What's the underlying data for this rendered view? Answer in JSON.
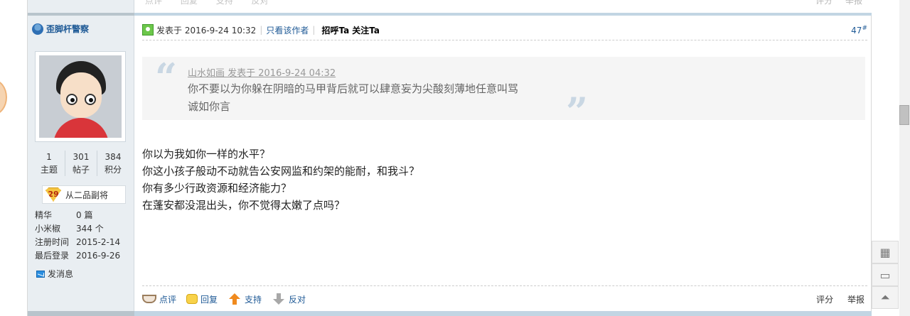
{
  "prev_post": {
    "actions": [
      "点评",
      "回复",
      "支持",
      "反对"
    ],
    "right": [
      "评分",
      "举报"
    ]
  },
  "author": {
    "name": "歪脚杆警察",
    "stats": [
      {
        "num": "1",
        "label": "主题"
      },
      {
        "num": "301",
        "label": "帖子"
      },
      {
        "num": "384",
        "label": "积分"
      }
    ],
    "rank_level": "29",
    "rank_title": "从二品副将",
    "info": [
      {
        "k": "精华",
        "v": "0 篇"
      },
      {
        "k": "小米椒",
        "v": "344 个"
      },
      {
        "k": "注册时间",
        "v": "2015-2-14"
      },
      {
        "k": "最后登录",
        "v": "2016-9-26"
      }
    ],
    "message_label": "发消息"
  },
  "post": {
    "posted_at": "发表于 2016-9-24 10:32",
    "only_author": "只看该作者",
    "greet": "招呼Ta",
    "follow": "关注Ta",
    "floor": "47",
    "floor_mark": "#",
    "quote": {
      "header": "山水如画 发表于 2016-9-24 04:32",
      "lines": [
        "你不要以为你躲在阴暗的马甲背后就可以肆意妄为尖酸刻薄地任意叫骂",
        "诚如你言"
      ]
    },
    "content": [
      "你以为我如你一样的水平？",
      "你这小孩子般动不动就告公安网监和约架的能耐，和我斗？",
      "你有多少行政资源和经济能力？",
      "在蓬安都没混出头，你不觉得太嫩了点吗？"
    ],
    "actions": [
      "点评",
      "回复",
      "支持",
      "反对"
    ],
    "right_actions": [
      "评分",
      "举报"
    ]
  },
  "rail": {
    "icons": [
      "qr-code-icon",
      "comment-icon",
      "back-to-top-icon"
    ]
  }
}
